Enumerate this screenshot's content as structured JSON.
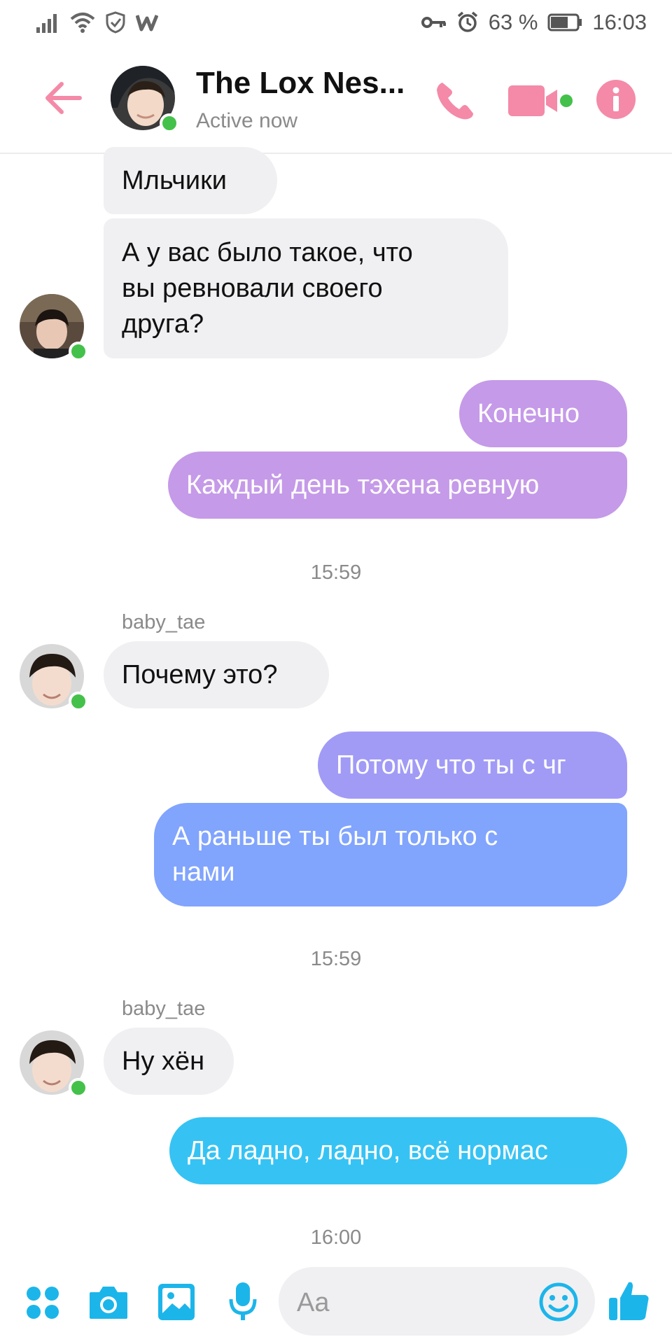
{
  "status_bar": {
    "battery": "63 %",
    "time": "16:03"
  },
  "header": {
    "title": "The Lox Nes...",
    "subtitle": "Active now"
  },
  "messages": {
    "m1": "Мльчики",
    "m2_l1": "А у вас было такое, что",
    "m2_l2": "вы ревновали своего",
    "m2_l3": "друга?",
    "m3": "Конечно",
    "m4": "Каждый день тэхена ревную",
    "t1": "15:59",
    "s1": "baby_tae",
    "m5": "Почему это?",
    "m6": "Потому что ты с чг",
    "m7_l1": "А раньше ты был только с",
    "m7_l2": "нами",
    "t2": "15:59",
    "s2": "baby_tae",
    "m8": "Ну хён",
    "m9": "Да ладно, ладно, всё нормас",
    "t3": "16:00"
  },
  "composer": {
    "placeholder": "Aa"
  },
  "colors": {
    "accent_pink": "#f48aa8",
    "bubble_purple": "#c59ae8",
    "bubble_blue": "#81a4fd",
    "bubble_cyan": "#36c3f4",
    "composer_blue": "#1cb5ea",
    "online": "#44c14a"
  },
  "icons": [
    "signal-icon",
    "wifi-icon",
    "shield-icon",
    "w-app-icon",
    "key-icon",
    "alarm-icon",
    "battery-icon",
    "back-arrow-icon",
    "phone-icon",
    "video-icon",
    "info-icon",
    "apps-grid-icon",
    "camera-icon",
    "gallery-icon",
    "microphone-icon",
    "emoji-icon",
    "thumbs-up-icon"
  ]
}
